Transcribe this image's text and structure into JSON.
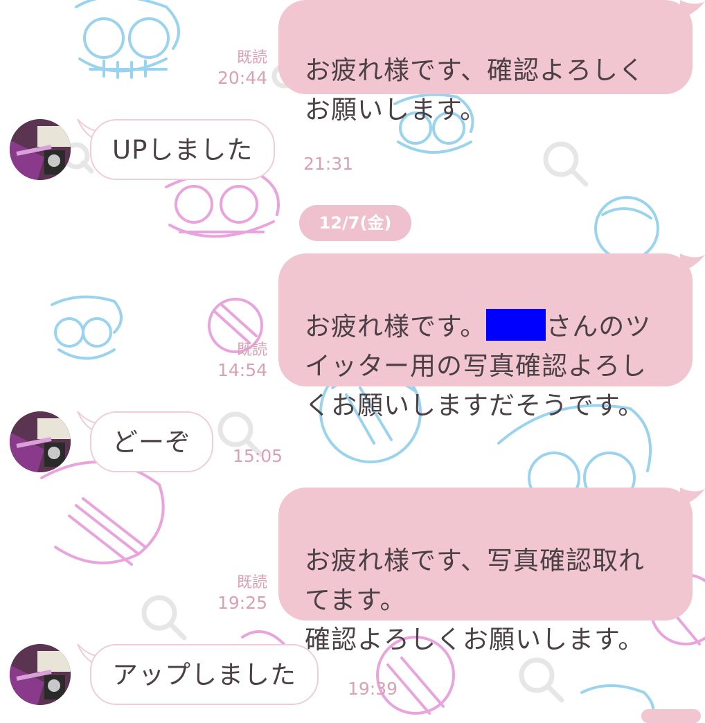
{
  "colors": {
    "outgoing_bubble": "#f2c6d1",
    "incoming_bubble": "#ffffff",
    "meta_text": "#dca0b3",
    "date_pill": "#efc0cd",
    "redaction": "#0000ff",
    "wallpaper_blue": "#9ad3ee",
    "wallpaper_pink": "#e9a3dd"
  },
  "date_separator": "12/7(金)",
  "messages": [
    {
      "direction": "outgoing",
      "text": "お疲れ様です、確認よろしく\nお願いします。",
      "read": "既読",
      "time": "20:44"
    },
    {
      "direction": "incoming",
      "text": "UPしました",
      "time": "21:31"
    },
    {
      "direction": "outgoing",
      "text_before": "お疲れ様です。",
      "text_after": "さんのツ\nイッター用の写真確認よろし\nくお願いしますだそうです。",
      "redacted": true,
      "read": "既読",
      "time": "14:54"
    },
    {
      "direction": "incoming",
      "text": "どーぞ",
      "time": "15:05"
    },
    {
      "direction": "outgoing",
      "text": "お疲れ様です、写真確認取れ\nてます。\n確認よろしくお願いします。",
      "read": "既読",
      "time": "19:25"
    },
    {
      "direction": "incoming",
      "text": "アップしました",
      "time": "19:39"
    }
  ],
  "icons": [
    "search-icon",
    "avatar-image"
  ]
}
